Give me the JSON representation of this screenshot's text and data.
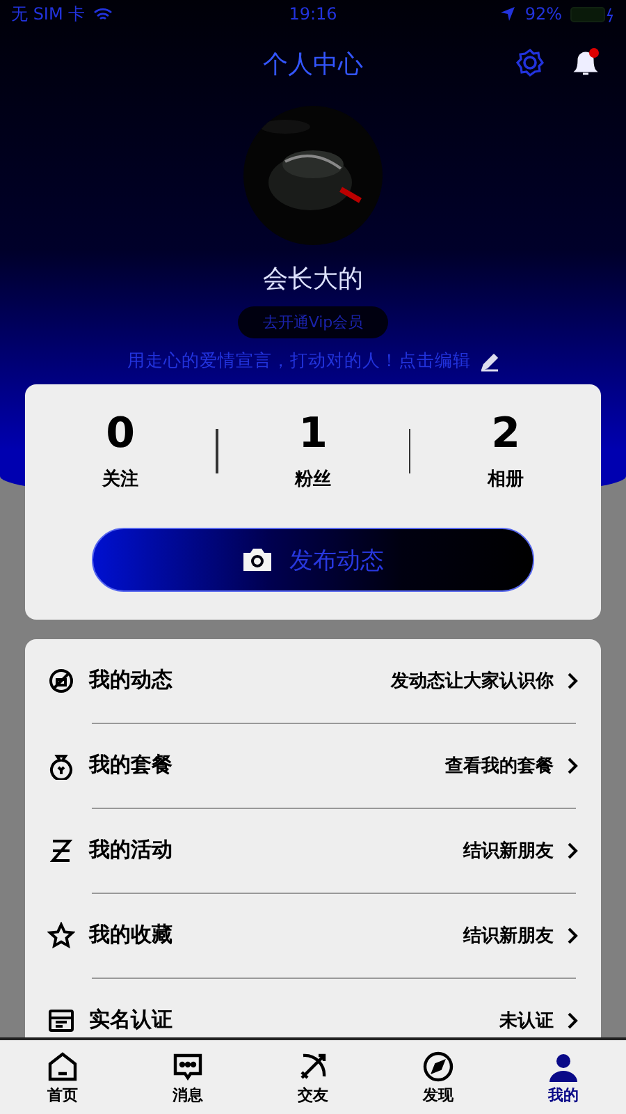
{
  "status_bar": {
    "carrier": "无 SIM 卡",
    "time": "19:16",
    "battery": "92%"
  },
  "header": {
    "title": "个人中心",
    "has_notification": true
  },
  "profile": {
    "name": "会长大的",
    "vip": "去开通Vip会员",
    "motto": "用走心的爱情宣言，打动对的人！点击编辑"
  },
  "stats": [
    {
      "value": "0",
      "label": "关注"
    },
    {
      "value": "1",
      "label": "粉丝"
    },
    {
      "value": "2",
      "label": "相册"
    }
  ],
  "publish_button": "发布动态",
  "menu": [
    {
      "kind": "moment",
      "label": "我的动态",
      "hint": "发动态让大家认识你"
    },
    {
      "kind": "package",
      "label": "我的套餐",
      "hint": "查看我的套餐"
    },
    {
      "kind": "activity",
      "label": "我的活动",
      "hint": "结识新朋友"
    },
    {
      "kind": "favorite",
      "label": "我的收藏",
      "hint": "结识新朋友"
    },
    {
      "kind": "verify",
      "label": "实名认证",
      "hint": "未认证"
    }
  ],
  "tabs": [
    {
      "kind": "home",
      "label": "首页",
      "selected": false
    },
    {
      "kind": "message",
      "label": "消息",
      "selected": false
    },
    {
      "kind": "friends",
      "label": "交友",
      "selected": false
    },
    {
      "kind": "discover",
      "label": "发现",
      "selected": false
    },
    {
      "kind": "me",
      "label": "我的",
      "selected": true
    }
  ]
}
